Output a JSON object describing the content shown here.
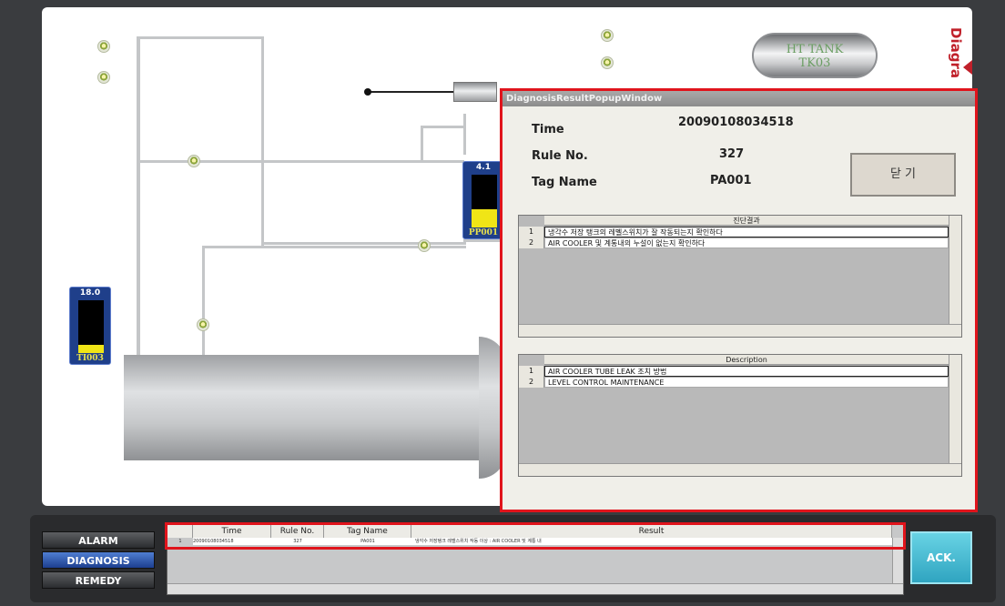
{
  "side_tab": {
    "label": "Diagra"
  },
  "process": {
    "ht_tank": {
      "line1": "HT TANK",
      "line2": "TK03"
    },
    "gauges": [
      {
        "value": "18.0",
        "tag": "TI003",
        "level": 0.16
      },
      {
        "value": "4.1",
        "tag": "PP001",
        "level": 0.35
      }
    ]
  },
  "popup": {
    "title": "DiagnosisResultPopupWindow",
    "time_label": "Time",
    "time_value": "20090108034518",
    "rule_label": "Rule No.",
    "rule_value": "327",
    "tag_label": "Tag Name",
    "tag_value": "PA001",
    "close_label": "닫 기",
    "diagnosis_grid": {
      "header": "진단결과",
      "rows": [
        {
          "index": "1",
          "text": "냉각수 저장 탱크의 레벨스위치가 잘 작동되는지 확인하다"
        },
        {
          "index": "2",
          "text": "AIR COOLER 및 계통내의 누설이 없는지 확인하다"
        }
      ]
    },
    "description_grid": {
      "header": "Description",
      "rows": [
        {
          "index": "1",
          "text": "AIR COOLER TUBE LEAK 조치 방법"
        },
        {
          "index": "2",
          "text": "LEVEL CONTROL MAINTENANCE"
        }
      ]
    }
  },
  "bottom": {
    "tabs": {
      "alarm": "ALARM",
      "diagnosis": "DIAGNOSIS",
      "remedy": "REMEDY"
    },
    "active_tab": "DIAGNOSIS",
    "result_grid": {
      "headers": {
        "time": "Time",
        "rule": "Rule No.",
        "tag": "Tag Name",
        "result": "Result"
      },
      "row": {
        "index": "1",
        "time": "20090108034518",
        "rule": "327",
        "tag": "PA001",
        "result": "냉각수 저장탱크 레벨스위치 작동 이상 : AIR COOLER 및 계통 내"
      }
    },
    "ack_label": "ACK."
  }
}
